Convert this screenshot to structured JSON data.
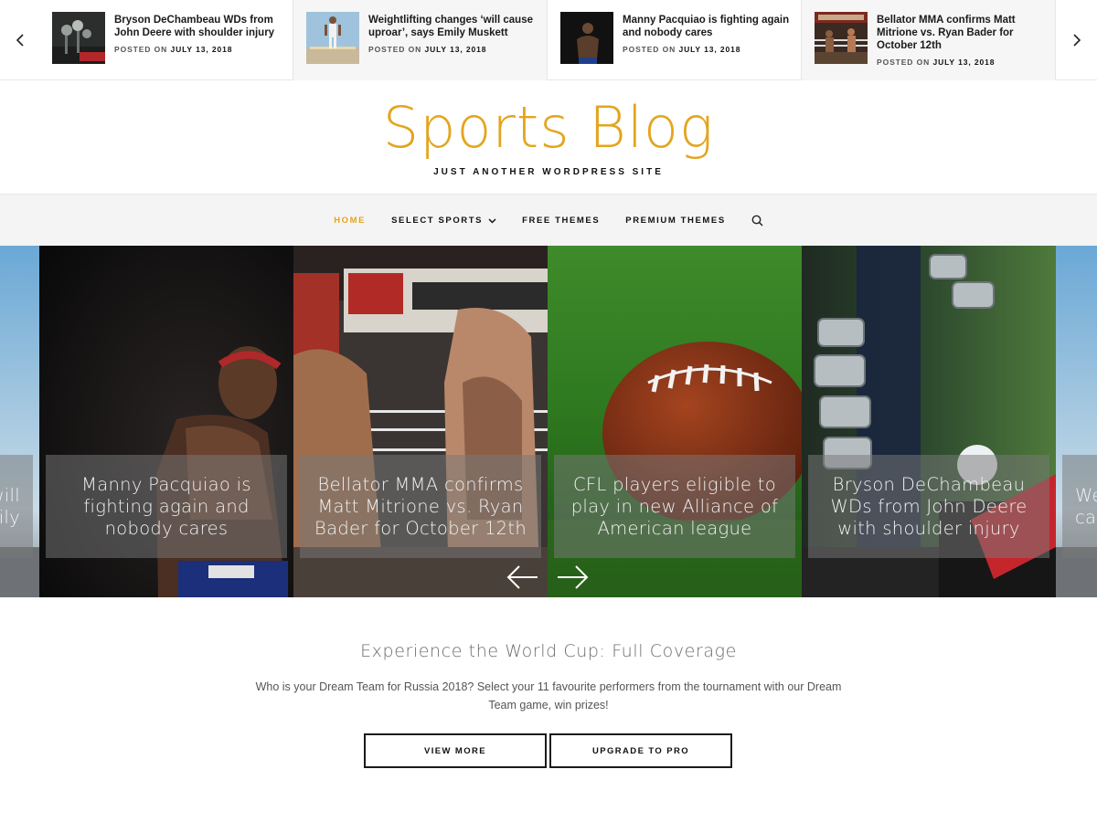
{
  "ticker": {
    "items": [
      {
        "title": "Bryson DeChambeau WDs from John Deere with shoulder injury",
        "posted_label": "POSTED ON",
        "date": "JULY 13, 2018"
      },
      {
        "title": "Weightlifting changes ‘will cause uproar’, says Emily Muskett",
        "posted_label": "POSTED ON",
        "date": "JULY 13, 2018"
      },
      {
        "title": "Manny Pacquiao is fighting again and nobody cares",
        "posted_label": "POSTED ON",
        "date": "JULY 13, 2018"
      },
      {
        "title": "Bellator MMA confirms Matt Mitrione vs. Ryan Bader for October 12th",
        "posted_label": "POSTED ON",
        "date": "JULY 13, 2018"
      }
    ]
  },
  "header": {
    "site_title": "Sports Blog",
    "tagline": "JUST ANOTHER WORDPRESS SITE"
  },
  "nav": {
    "items": [
      "HOME",
      "SELECT SPORTS",
      "FREE THEMES",
      "PREMIUM THEMES"
    ],
    "active": "HOME"
  },
  "slider": {
    "partial_left": "will\nily",
    "slides": [
      {
        "caption": "Manny Pacquiao is fighting again and nobody cares"
      },
      {
        "caption": "Bellator MMA confirms Matt Mitrione vs. Ryan Bader for October 12th"
      },
      {
        "caption": "CFL players eligible to play in new Alliance of American league"
      },
      {
        "caption": "Bryson DeChambeau WDs from John Deere with shoulder injury"
      }
    ],
    "partial_right": "We\nca"
  },
  "content": {
    "title": "Experience the World Cup: Full Coverage",
    "text": "Who is your Dream Team for Russia 2018? Select your 11 favourite performers from the tournament with our Dream Team game, win prizes!",
    "view_more": "VIEW MORE",
    "upgrade": "UPGRADE TO PRO"
  },
  "colors": {
    "accent": "#e3a51f",
    "text_dark": "#111111",
    "muted": "#6c6c6c"
  },
  "icons": {
    "ticker_prev": "chevron-left-icon",
    "ticker_next": "chevron-right-icon",
    "nav_dropdown": "chevron-down-icon",
    "search": "search-icon",
    "slider_prev": "arrow-left-icon",
    "slider_next": "arrow-right-icon"
  }
}
